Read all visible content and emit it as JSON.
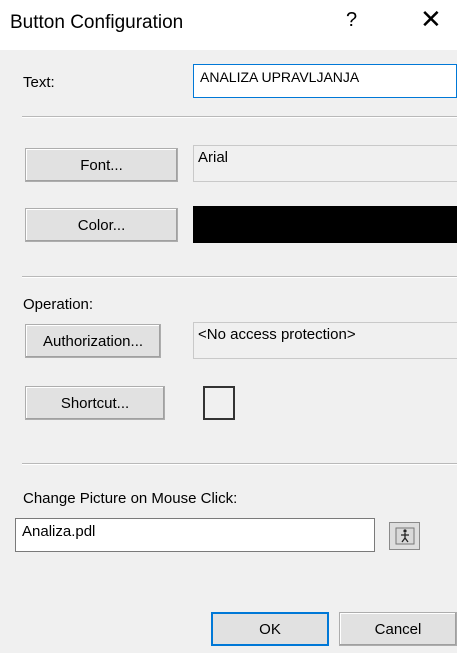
{
  "window": {
    "title": "Button Configuration",
    "help_glyph": "?",
    "close_glyph": "✕"
  },
  "text_field": {
    "label": "Text:",
    "value": "ANALIZA UPRAVLJANJA"
  },
  "font": {
    "button_label": "Font...",
    "value": "Arial"
  },
  "color": {
    "button_label": "Color...",
    "value": "#000000"
  },
  "operation": {
    "label": "Operation:",
    "authorization_label": "Authorization...",
    "authorization_value": "<No access protection>",
    "shortcut_label": "Shortcut...",
    "shortcut_checked": false
  },
  "picture": {
    "label": "Change Picture on Mouse Click:",
    "value": "Analiza.pdl"
  },
  "footer": {
    "ok_label": "OK",
    "cancel_label": "Cancel"
  }
}
